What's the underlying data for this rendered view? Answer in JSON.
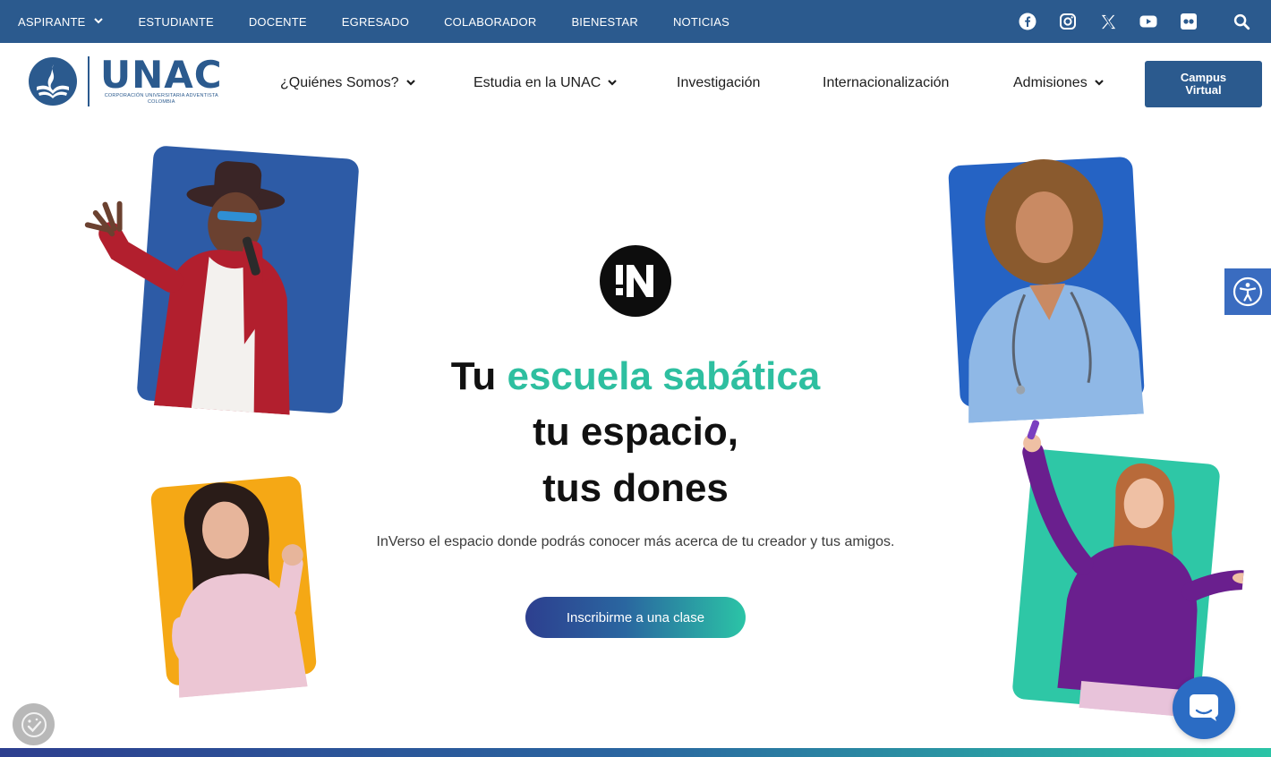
{
  "topbar": {
    "items": [
      {
        "label": "ASPIRANTE",
        "has_dropdown": true
      },
      {
        "label": "ESTUDIANTE"
      },
      {
        "label": "DOCENTE"
      },
      {
        "label": "EGRESADO"
      },
      {
        "label": "COLABORADOR"
      },
      {
        "label": "BIENESTAR"
      },
      {
        "label": "NOTICIAS"
      }
    ],
    "socials": [
      "facebook-icon",
      "instagram-icon",
      "x-icon",
      "youtube-icon",
      "flickr-icon"
    ],
    "search_icon": "search-icon",
    "background": "#2b5a8e"
  },
  "header": {
    "logo": {
      "wordmark": "UNAC",
      "subtitle_line1": "CORPORACIÓN UNIVERSITARIA ADVENTISTA",
      "subtitle_line2": "COLOMBIA"
    },
    "nav": [
      {
        "label": "¿Quiénes Somos?",
        "has_dropdown": true
      },
      {
        "label": "Estudia en la UNAC",
        "has_dropdown": true
      },
      {
        "label": "Investigación",
        "has_dropdown": false
      },
      {
        "label": "Internacionalización",
        "has_dropdown": false
      },
      {
        "label": "Admisiones",
        "has_dropdown": true
      }
    ],
    "campus_button": {
      "line1": "Campus",
      "line2": "Virtual"
    }
  },
  "hero": {
    "badge_text": "!N",
    "headline_prefix": "Tu",
    "headline_accent": "escuela sabática",
    "headline_line2": "tu espacio,",
    "headline_line3": "tus dones",
    "lead": "InVerso el espacio donde podrás conocer más acerca de tu creador y tus amigos.",
    "cta": "Inscribirme a una clase",
    "accent_color": "#2ebfa0",
    "cards": [
      {
        "name": "card-singer",
        "color": "#2d5ba6"
      },
      {
        "name": "card-woman-pink",
        "color": "#f5a815"
      },
      {
        "name": "card-nurse",
        "color": "#2563c4"
      },
      {
        "name": "card-woman-purple",
        "color": "#2ec7a6"
      }
    ]
  },
  "widgets": {
    "accessibility_icon": "accessibility-icon",
    "chat_icon": "chat-icon",
    "cookie_icon": "cookie-consent-icon"
  }
}
